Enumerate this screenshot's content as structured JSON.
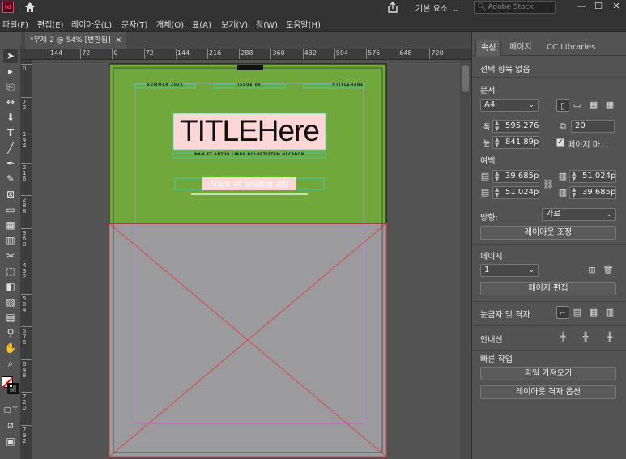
{
  "app": {
    "logo": "Id",
    "workspace_label": "기본 요소",
    "stock_search_placeholder": "Adobe Stock"
  },
  "menu": [
    "파일(F)",
    "편집(E)",
    "레이아웃(L)",
    "문자(T)",
    "개체(O)",
    "표(A)",
    "보기(V)",
    "창(W)",
    "도움말(H)"
  ],
  "document_tab": {
    "label": "*무제-2 @ 54% [변환됨]",
    "close": "×"
  },
  "ruler": {
    "horizontal": [
      "144",
      "72",
      "0",
      "72",
      "144",
      "216",
      "288",
      "360",
      "432",
      "504",
      "576",
      "648",
      "720"
    ],
    "vertical": [
      "0",
      "72",
      "144",
      "216",
      "288",
      "360",
      "432",
      "504",
      "576",
      "648",
      "720",
      "792"
    ]
  },
  "page": {
    "header_left": "SUMMER 2022",
    "header_center": "ISSUE 00",
    "header_right": "#TITLEHERE",
    "title": "TITLEHere",
    "subtitle": "NAM ET ANTUR LIBUS DOLUPTISTEM NECABOR",
    "body_text": "Nam et ellabor eiu",
    "colors": {
      "top_fill": "#70a83c",
      "bottom_fill": "#9b9b9d",
      "text_frame_fill": "#ffd6d6",
      "frame_line": "#d84a4a"
    }
  },
  "panel": {
    "tabs": [
      "속성",
      "페이지",
      "CC Libraries"
    ],
    "active_tab": 0,
    "no_selection": "선택 항목 없음",
    "doc_section": "문서",
    "preset": "A4",
    "width_label": "폭",
    "width_value": "595.276p",
    "height_label": "높",
    "height_value": "841.89pt",
    "pages_value": "20",
    "facing_pages_label": "페이지 마...",
    "margin_section": "여백",
    "margin_top": "39.685pt",
    "margin_bottom": "51.024pt",
    "margin_inside": "51.024pt",
    "margin_outside": "39.685pt",
    "orientation_label": "방향:",
    "orientation_value": "가로",
    "adjust_layout_button": "레이아웃 조정",
    "page_section": "페이지",
    "page_value": "1",
    "edit_page_button": "페이지 편집",
    "grids_section": "눈금자 및 격자",
    "guides_section": "안내선",
    "quick_actions_section": "빠른 작업",
    "import_button": "파일 가져오기",
    "layout_grid_button": "레이아웃 격자 옵션"
  }
}
